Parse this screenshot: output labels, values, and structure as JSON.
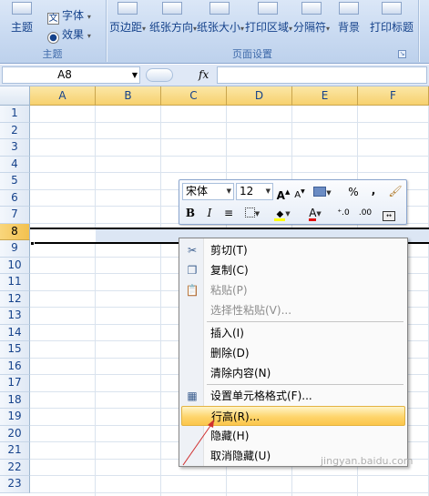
{
  "ribbon": {
    "theme_group": {
      "theme_button": "主题",
      "fonts_button": "字体",
      "effects_button": "效果",
      "group_label": "主题"
    },
    "page_setup_group": {
      "margins_button": "页边距",
      "orientation_button": "纸张方向",
      "size_button": "纸张大小",
      "print_area_button": "打印区域",
      "breaks_button": "分隔符",
      "background_button": "背景",
      "print_titles_button": "打印标题",
      "group_label": "页面设置"
    }
  },
  "formula_bar": {
    "name_box": "A8",
    "fx_label": "fx",
    "content": ""
  },
  "sheet": {
    "columns": [
      "A",
      "B",
      "C",
      "D",
      "E",
      "F"
    ],
    "rows": [
      "1",
      "2",
      "3",
      "4",
      "5",
      "6",
      "7",
      "8",
      "9",
      "10",
      "11",
      "12",
      "13",
      "14",
      "15",
      "16",
      "17",
      "18",
      "19",
      "20",
      "21",
      "22",
      "23"
    ],
    "selected_row": "8"
  },
  "mini_toolbar": {
    "font": "宋体",
    "size": "12",
    "bold": "B",
    "italic": "I",
    "percent": "%",
    "comma": ","
  },
  "context_menu": {
    "items": [
      {
        "label": "剪切(T)",
        "enabled": true,
        "icon": "scissors-icon"
      },
      {
        "label": "复制(C)",
        "enabled": true,
        "icon": "copy-icon"
      },
      {
        "label": "粘贴(P)",
        "enabled": false,
        "icon": "paste-icon"
      },
      {
        "label": "选择性粘贴(V)...",
        "enabled": false,
        "icon": ""
      },
      {
        "label": "插入(I)",
        "enabled": true,
        "icon": ""
      },
      {
        "label": "删除(D)",
        "enabled": true,
        "icon": ""
      },
      {
        "label": "清除内容(N)",
        "enabled": true,
        "icon": ""
      },
      {
        "label": "设置单元格格式(F)...",
        "enabled": true,
        "icon": "format-cells-icon"
      },
      {
        "label": "行高(R)...",
        "enabled": true,
        "icon": "",
        "highlighted": true
      },
      {
        "label": "隐藏(H)",
        "enabled": true,
        "icon": ""
      },
      {
        "label": "取消隐藏(U)",
        "enabled": true,
        "icon": ""
      }
    ]
  },
  "watermark": "jingyan.baidu.com"
}
